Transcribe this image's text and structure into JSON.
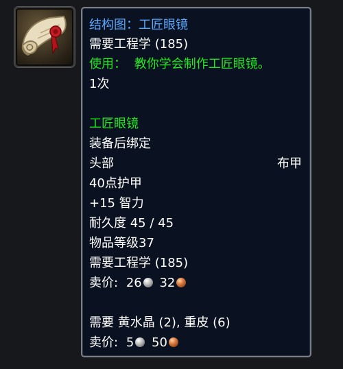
{
  "item_icon": {
    "name": "scroll-icon"
  },
  "tooltip": {
    "title": "结构图：工匠眼镜",
    "requires": "需要工程学 (185)",
    "use_label": "使用：",
    "use_text": "教你学会制作工匠眼镜。",
    "charges": "1次",
    "result": {
      "name": "工匠眼镜",
      "bind": "装备后绑定",
      "slot": "头部",
      "armor_type": "布甲",
      "armor": "40点护甲",
      "stat": "+15 智力",
      "durability": "耐久度 45 / 45",
      "item_level": "物品等级37",
      "requires": "需要工程学 (185)",
      "sell_label": "卖价:",
      "sell_silver": "26",
      "sell_copper": "32"
    },
    "reagents": "需要 黄水晶 (2), 重皮 (6)",
    "sell_label": "卖价:",
    "sell_silver": "5",
    "sell_copper": "50"
  },
  "colors": {
    "title": "#5aa9ff",
    "use": "#22e622",
    "text": "#ffffff",
    "background": "#0a1120"
  }
}
